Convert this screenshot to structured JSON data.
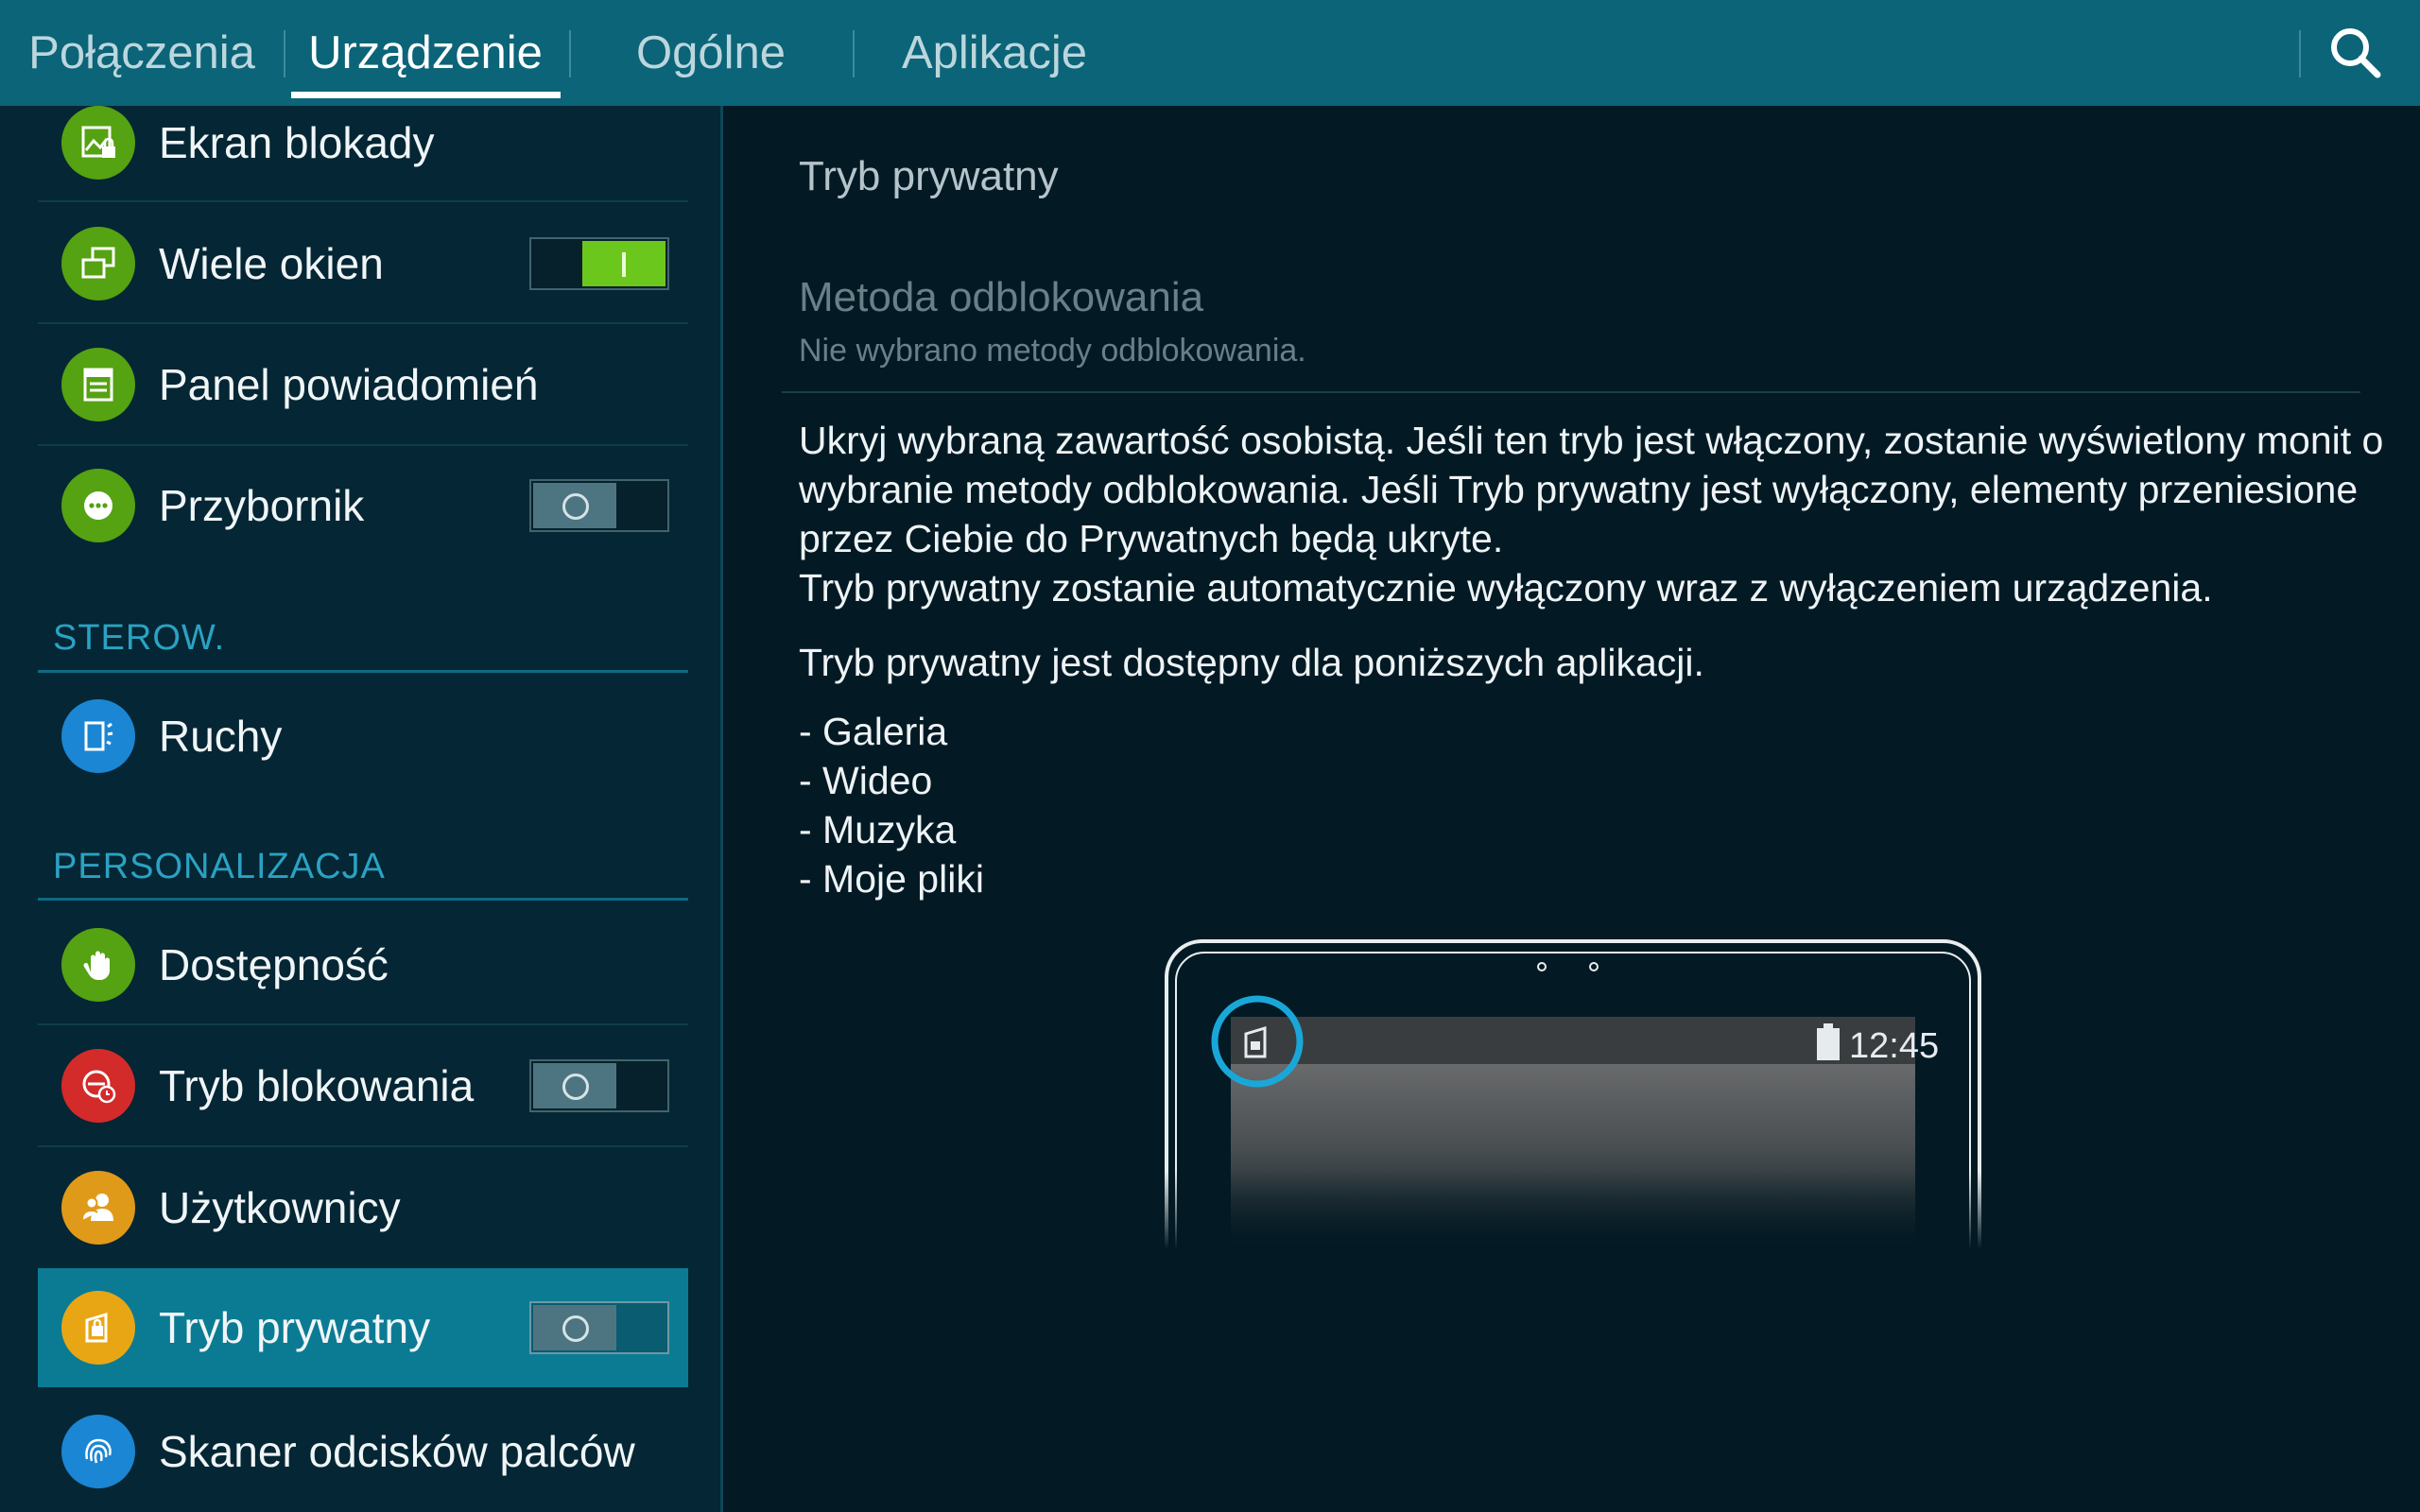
{
  "tabs": [
    {
      "label": "Połączenia"
    },
    {
      "label": "Urządzenie"
    },
    {
      "label": "Ogólne"
    },
    {
      "label": "Aplikacje"
    }
  ],
  "active_tab": "Urządzenie",
  "sidebar": {
    "items": [
      {
        "label": "Ekran blokady",
        "icon": "lock-screen-icon",
        "color": "#55a212"
      },
      {
        "label": "Wiele okien",
        "icon": "multi-window-icon",
        "color": "#55a212",
        "toggle": "on"
      },
      {
        "label": "Panel powiadomień",
        "icon": "notification-panel-icon",
        "color": "#55a212"
      },
      {
        "label": "Przybornik",
        "icon": "toolbox-icon",
        "color": "#55a212",
        "toggle": "off"
      },
      {
        "label": "Ruchy",
        "icon": "motions-icon",
        "color": "#1b86d3"
      },
      {
        "label": "Dostępność",
        "icon": "accessibility-hand-icon",
        "color": "#55a212"
      },
      {
        "label": "Tryb blokowania",
        "icon": "blocking-mode-icon",
        "color": "#d32a2a",
        "toggle": "off"
      },
      {
        "label": "Użytkownicy",
        "icon": "users-icon",
        "color": "#e09a1a"
      },
      {
        "label": "Tryb prywatny",
        "icon": "private-mode-icon",
        "color": "#e9a614",
        "toggle": "off",
        "selected": true
      },
      {
        "label": "Skaner odcisków palców",
        "icon": "fingerprint-icon",
        "color": "#1b86d3"
      }
    ],
    "sections": [
      {
        "label": "STEROW."
      },
      {
        "label": "PERSONALIZACJA"
      }
    ]
  },
  "detail": {
    "title": "Tryb prywatny",
    "method_label": "Metoda odblokowania",
    "method_sub": "Nie wybrano metody odblokowania.",
    "description_1": "Ukryj wybraną zawartość osobistą. Jeśli ten tryb jest włączony, zostanie wyświetlony monit o wybranie metody odblokowania. Jeśli Tryb prywatny jest wyłączony, elementy przeniesione przez Ciebie do Prywatnych będą ukryte.",
    "description_2": "Tryb prywatny zostanie automatycznie wyłączony wraz z wyłączeniem urządzenia.",
    "available_label": "Tryb prywatny jest dostępny dla poniższych aplikacji.",
    "apps": [
      "- Galeria",
      "- Wideo",
      "- Muzyka",
      "- Moje pliki"
    ],
    "illustration_clock": "12:45"
  },
  "colors": {
    "tab_bar": "#0b6478",
    "selected_row": "#0b7b94",
    "section_header": "#2aa2c3",
    "toggle_on": "#6bc71c",
    "highlight_ring": "#1aa7d8"
  }
}
